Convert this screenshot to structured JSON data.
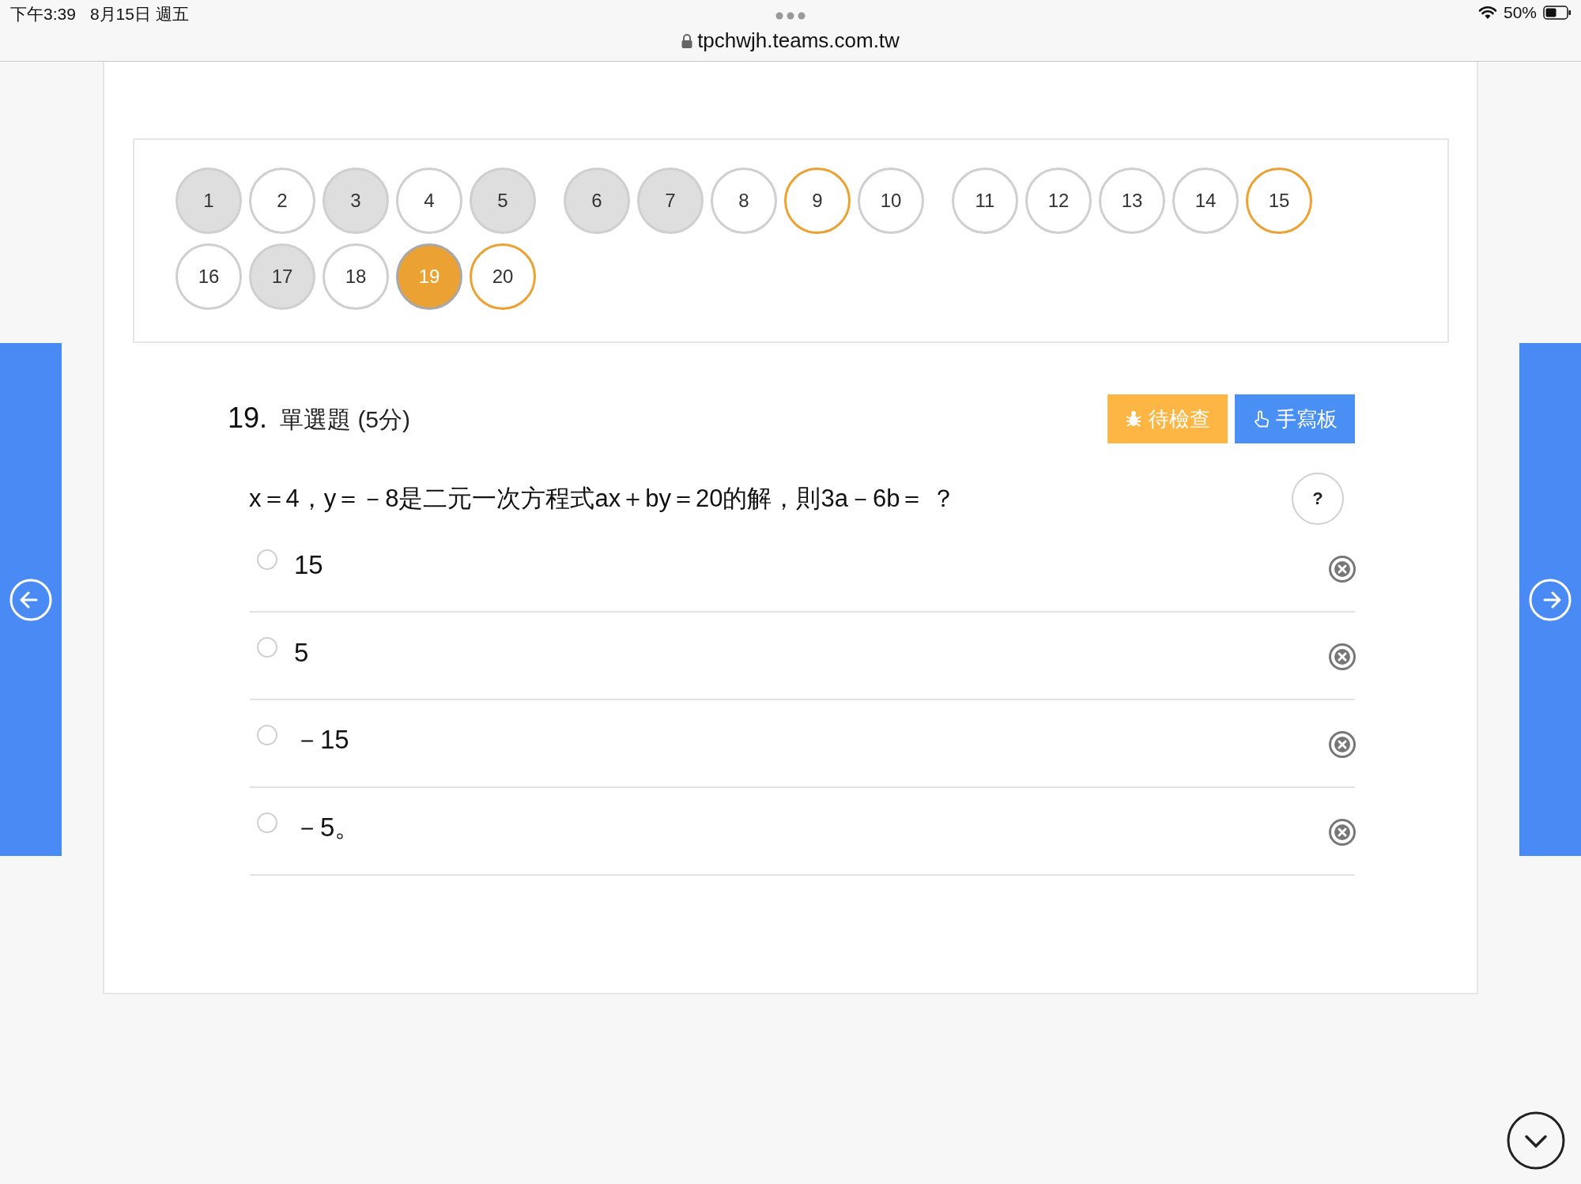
{
  "status_bar": {
    "time": "下午3:39",
    "date": "8月15日 週五",
    "url": "tpchwjh.teams.com.tw",
    "battery": "50%"
  },
  "question_nav": [
    {
      "label": "1",
      "answered": true,
      "flagged": false,
      "selected": false
    },
    {
      "label": "2",
      "answered": false,
      "flagged": false,
      "selected": false
    },
    {
      "label": "3",
      "answered": true,
      "flagged": false,
      "selected": false
    },
    {
      "label": "4",
      "answered": false,
      "flagged": false,
      "selected": false
    },
    {
      "label": "5",
      "answered": true,
      "flagged": false,
      "selected": false
    },
    {
      "label": "6",
      "answered": true,
      "flagged": false,
      "selected": false
    },
    {
      "label": "7",
      "answered": true,
      "flagged": false,
      "selected": false
    },
    {
      "label": "8",
      "answered": false,
      "flagged": false,
      "selected": false
    },
    {
      "label": "9",
      "answered": false,
      "flagged": true,
      "selected": false
    },
    {
      "label": "10",
      "answered": false,
      "flagged": false,
      "selected": false
    },
    {
      "label": "11",
      "answered": false,
      "flagged": false,
      "selected": false
    },
    {
      "label": "12",
      "answered": false,
      "flagged": false,
      "selected": false
    },
    {
      "label": "13",
      "answered": false,
      "flagged": false,
      "selected": false
    },
    {
      "label": "14",
      "answered": false,
      "flagged": false,
      "selected": false
    },
    {
      "label": "15",
      "answered": false,
      "flagged": true,
      "selected": false
    },
    {
      "label": "16",
      "answered": false,
      "flagged": false,
      "selected": false
    },
    {
      "label": "17",
      "answered": true,
      "flagged": false,
      "selected": false
    },
    {
      "label": "18",
      "answered": false,
      "flagged": false,
      "selected": false
    },
    {
      "label": "19",
      "answered": false,
      "flagged": false,
      "selected": true
    },
    {
      "label": "20",
      "answered": false,
      "flagged": true,
      "selected": false
    }
  ],
  "question": {
    "number": "19.",
    "type": "單選題 (5分)",
    "buttons": [
      {
        "kind": "review",
        "label": "待檢查"
      },
      {
        "kind": "handwriting",
        "label": "手寫板"
      }
    ],
    "text": "x＝4，y＝－8是二元一次方程式ax＋by＝20的解，則3a－6b＝ ？",
    "help": "?",
    "options": [
      {
        "label": "15",
        "selected": false
      },
      {
        "label": "5",
        "selected": false
      },
      {
        "label": "－15",
        "selected": false
      },
      {
        "label": "－5。",
        "selected": false
      }
    ]
  }
}
